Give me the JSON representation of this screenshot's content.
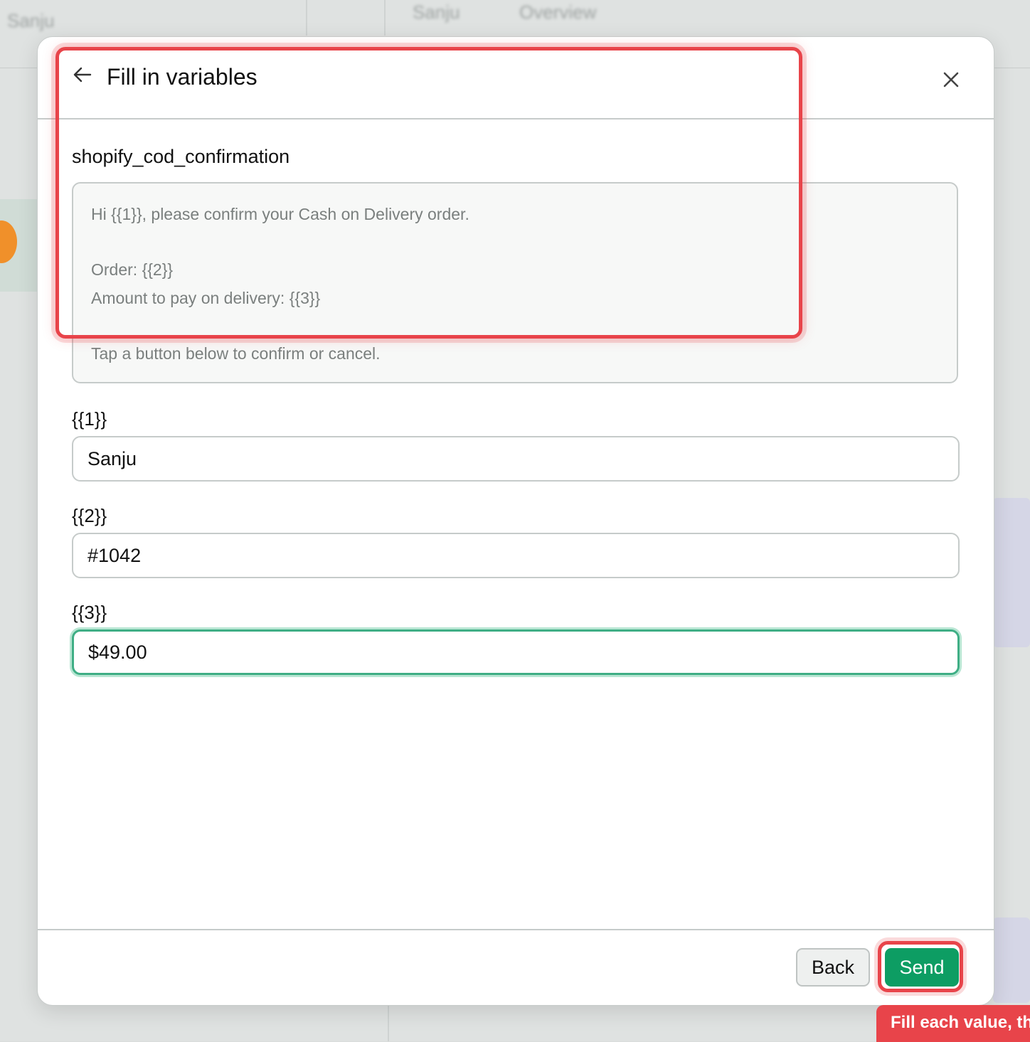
{
  "background": {
    "breadcrumb_fragment": "Sanju",
    "tab_fragment": "Sanju",
    "tab_fragment_2": "Overview"
  },
  "modal": {
    "title": "Fill in variables",
    "template_name": "shopify_cod_confirmation",
    "preview_lines": [
      "Hi {{1}}, please confirm your Cash on Delivery order.",
      "Order: {{2}}",
      "Amount to pay on delivery: {{3}}",
      "Tap a button below to confirm or cancel."
    ],
    "variables": [
      {
        "label": "{{1}}",
        "value": "Sanju"
      },
      {
        "label": "{{2}}",
        "value": "#1042"
      },
      {
        "label": "{{3}}",
        "value": "$49.00"
      }
    ],
    "back_label": "Back",
    "send_label": "Send"
  },
  "tooltip": {
    "text": "Fill each value, then"
  },
  "colors": {
    "accent": "#0d9d63",
    "focus_ring": "#3fae85",
    "highlight": "#e8444a"
  }
}
